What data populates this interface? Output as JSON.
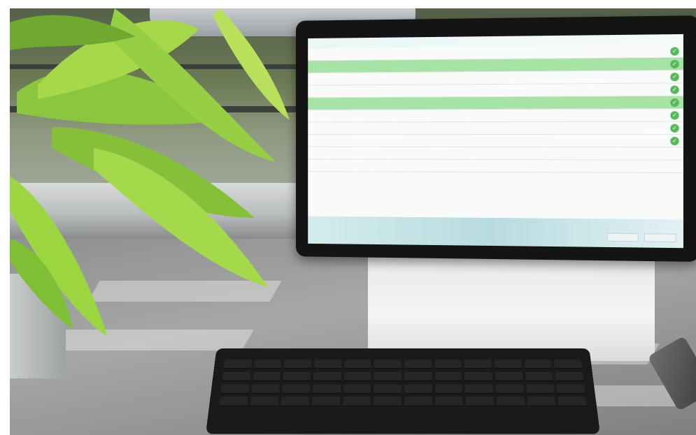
{
  "screen": {
    "title": "",
    "rows": [
      {
        "name": "",
        "status": "",
        "checked": true,
        "highlight": false
      },
      {
        "name": "",
        "status": "",
        "checked": true,
        "highlight": true
      },
      {
        "name": "",
        "status": "",
        "checked": true,
        "highlight": false
      },
      {
        "name": "",
        "status": "",
        "checked": true,
        "highlight": false
      },
      {
        "name": "",
        "status": "",
        "checked": true,
        "highlight": true
      },
      {
        "name": "",
        "status": "",
        "checked": true,
        "highlight": false
      },
      {
        "name": "",
        "status": "",
        "checked": true,
        "highlight": false
      },
      {
        "name": "",
        "status": "",
        "checked": true,
        "highlight": false
      },
      {
        "name": "",
        "status": "",
        "checked": false,
        "highlight": false
      },
      {
        "name": "",
        "status": "",
        "checked": false,
        "highlight": false
      }
    ],
    "buttons": [
      "",
      ""
    ],
    "check_icon": "checkmark-icon"
  },
  "colors": {
    "highlight_row": "#a8e3a6",
    "check": "#57b95a",
    "title": "#58a8c8",
    "plant_leaf": "#9fd43e"
  }
}
